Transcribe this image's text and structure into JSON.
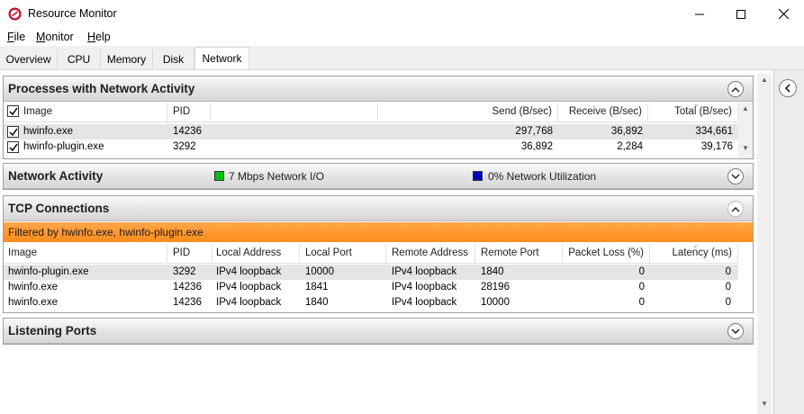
{
  "window": {
    "title": "Resource Monitor"
  },
  "menu": [
    {
      "label": "File",
      "mnemonic": "F",
      "rest": "ile"
    },
    {
      "label": "Monitor",
      "mnemonic": "M",
      "rest": "onitor"
    },
    {
      "label": "Help",
      "mnemonic": "H",
      "rest": "elp"
    }
  ],
  "tabs": [
    "Overview",
    "CPU",
    "Memory",
    "Disk",
    "Network"
  ],
  "active_tab": "Network",
  "processes": {
    "title": "Processes with Network Activity",
    "columns": [
      "Image",
      "PID",
      "Send (B/sec)",
      "Receive (B/sec)",
      "Total (B/sec)"
    ],
    "rows": [
      {
        "image": "hwinfo.exe",
        "pid": "14236",
        "send": "297,768",
        "receive": "36,892",
        "total": "334,661",
        "checked": true
      },
      {
        "image": "hwinfo-plugin.exe",
        "pid": "3292",
        "send": "36,892",
        "receive": "2,284",
        "total": "39,176",
        "checked": true
      }
    ]
  },
  "network_activity": {
    "title": "Network Activity",
    "io_label": "7 Mbps Network I/O",
    "util_label": "0% Network Utilization",
    "io_color": "#00c000",
    "util_color": "#0000c0"
  },
  "tcp": {
    "title": "TCP Connections",
    "filter": "Filtered by hwinfo.exe, hwinfo-plugin.exe",
    "columns": [
      "Image",
      "PID",
      "Local Address",
      "Local Port",
      "Remote Address",
      "Remote Port",
      "Packet Loss (%)",
      "Latency (ms)"
    ],
    "rows": [
      {
        "image": "hwinfo-plugin.exe",
        "pid": "3292",
        "local_address": "IPv4 loopback",
        "local_port": "10000",
        "remote_address": "IPv4 loopback",
        "remote_port": "1840",
        "packet_loss": "0",
        "latency": "0"
      },
      {
        "image": "hwinfo.exe",
        "pid": "14236",
        "local_address": "IPv4 loopback",
        "local_port": "1841",
        "remote_address": "IPv4 loopback",
        "remote_port": "28196",
        "packet_loss": "0",
        "latency": "0"
      },
      {
        "image": "hwinfo.exe",
        "pid": "14236",
        "local_address": "IPv4 loopback",
        "local_port": "1840",
        "remote_address": "IPv4 loopback",
        "remote_port": "10000",
        "packet_loss": "0",
        "latency": "0"
      }
    ]
  },
  "listening_ports": {
    "title": "Listening Ports"
  },
  "icons": {
    "app": "resource-monitor-icon",
    "minimize": "minimize-icon",
    "maximize": "maximize-icon",
    "close": "close-icon",
    "collapse": "chevron-up-icon",
    "expand": "chevron-down-icon",
    "side": "chevron-left-icon"
  },
  "accent": {
    "filter_bar": "#ff9a33",
    "selection": "#e5e5e5"
  }
}
